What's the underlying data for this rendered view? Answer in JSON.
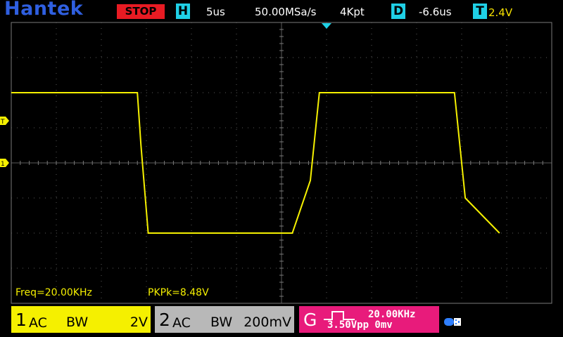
{
  "brand": "Hantek",
  "topbar": {
    "run_state": "STOP",
    "h_label": "H",
    "timebase": "5us",
    "sample_rate": "50.00MSa/s",
    "memory_depth": "4Kpt",
    "d_label": "D",
    "delay": "-6.6us",
    "t_label": "T",
    "trigger_level": "2.4V"
  },
  "markers": {
    "trigger_marker": "T",
    "ch1_marker": "1"
  },
  "measurements": {
    "freq": "Freq=20.00KHz",
    "pkpk": "PKPk=8.48V"
  },
  "ch1": {
    "num": "1",
    "coupling": "AC",
    "bw": "BW",
    "scale": "2V"
  },
  "ch2": {
    "num": "2",
    "coupling": "AC",
    "bw": "BW",
    "scale": "200mV"
  },
  "trigger": {
    "letter": "G",
    "freq": "20.00KHz",
    "amp": "3.50Vpp  0mv"
  },
  "colors": {
    "ch1": "#f5f000",
    "ch2": "#b8b8b8",
    "trigger": "#e81b7b",
    "stop": "#e81b23",
    "cyan": "#1fd0e6",
    "brand": "#2f5fe0"
  },
  "chart_data": {
    "type": "line",
    "series": [
      {
        "name": "1",
        "color": "#f5f000",
        "x": [
          -6.6,
          0.4,
          0.6,
          1.0,
          9.0,
          10.0,
          10.5,
          18.0,
          18.6,
          20.5
        ],
        "y": [
          4.0,
          4.0,
          1.0,
          -4.0,
          -4.0,
          -1.0,
          4.0,
          4.0,
          -2.0,
          -4.0
        ]
      }
    ],
    "x_unit": "us",
    "y_unit": "V",
    "xlim": [
      -6.6,
      23.4
    ],
    "ylim": [
      -8,
      8
    ],
    "grid": true
  }
}
